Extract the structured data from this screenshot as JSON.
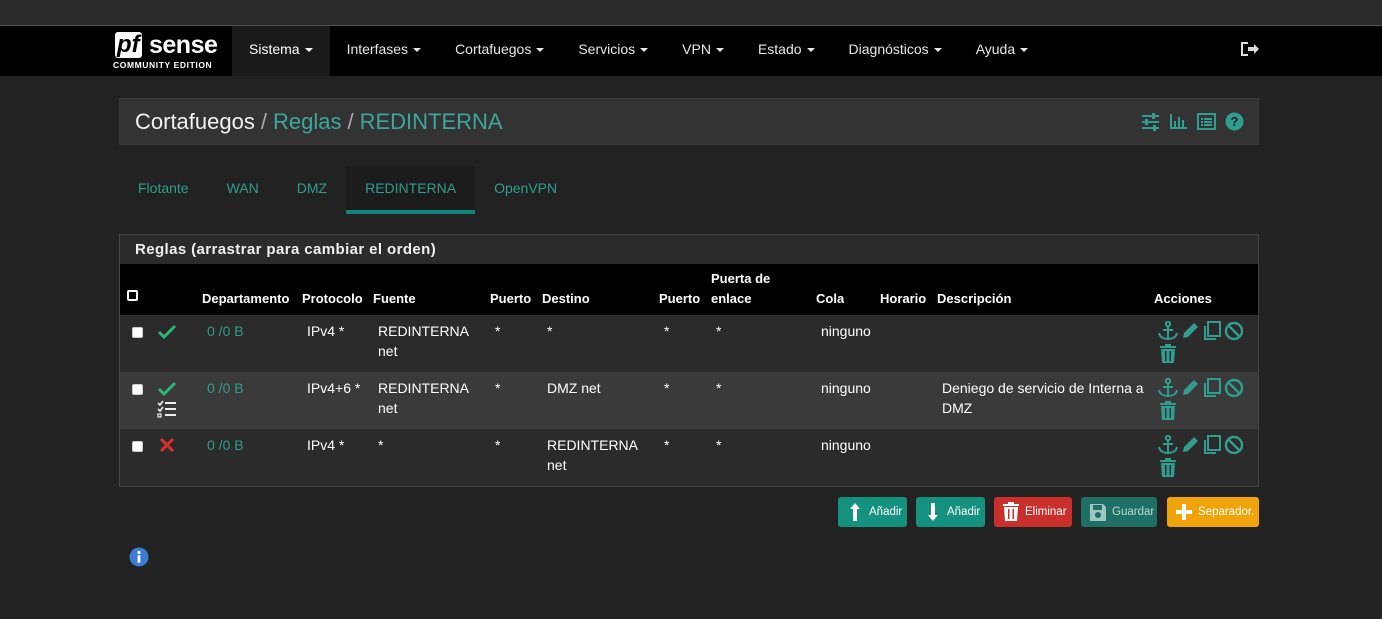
{
  "brand": {
    "logo_pf": "pf",
    "logo_sense": "sense",
    "edition": "COMMUNITY EDITION"
  },
  "nav": {
    "items": [
      {
        "label": "Sistema"
      },
      {
        "label": "Interfases"
      },
      {
        "label": "Cortafuegos"
      },
      {
        "label": "Servicios"
      },
      {
        "label": "VPN"
      },
      {
        "label": "Estado"
      },
      {
        "label": "Diagnósticos"
      },
      {
        "label": "Ayuda"
      }
    ],
    "active": "Sistema",
    "logout_icon": "sign-out-icon"
  },
  "breadcrumb": {
    "part1": "Cortafuegos",
    "sep": "/",
    "part2": "Reglas",
    "part3": "REDINTERNA"
  },
  "header_icons": [
    "sliders-icon",
    "bar-chart-icon",
    "list-icon",
    "help-icon"
  ],
  "tabs": [
    {
      "label": "Flotante"
    },
    {
      "label": "WAN"
    },
    {
      "label": "DMZ"
    },
    {
      "label": "REDINTERNA"
    },
    {
      "label": "OpenVPN"
    }
  ],
  "active_tab": "REDINTERNA",
  "rules": {
    "title": "Reglas (arrastrar para cambiar el orden)",
    "columns": {
      "departamento": "Departamento",
      "protocolo": "Protocolo",
      "fuente": "Fuente",
      "puerto1": "Puerto",
      "destino": "Destino",
      "puerto2": "Puerto",
      "puerta_line1": "Puerta de",
      "puerta_line2": "enlace",
      "cola": "Cola",
      "horario": "Horario",
      "descripcion": "Descripción",
      "acciones": "Acciones"
    },
    "rows": [
      {
        "status": "pass",
        "departamento": "0 /0 B",
        "protocolo": "IPv4 *",
        "fuente_l1": "REDINTERNA",
        "fuente_l2": "net",
        "puerto1": "*",
        "destino_l1": "*",
        "destino_l2": "",
        "puerto2": "*",
        "puerta": "*",
        "cola": "ninguno",
        "horario": "",
        "desc_l1": "",
        "desc_l2": ""
      },
      {
        "status": "pass",
        "has_list_icon": true,
        "departamento": "0 /0 B",
        "protocolo": "IPv4+6 *",
        "fuente_l1": "REDINTERNA",
        "fuente_l2": "net",
        "puerto1": "*",
        "destino_l1": "DMZ net",
        "destino_l2": "",
        "puerto2": "*",
        "puerta": "*",
        "cola": "ninguno",
        "horario": "",
        "desc_l1": "Deniego de servicio de Interna a",
        "desc_l2": "DMZ"
      },
      {
        "status": "block",
        "departamento": "0 /0 B",
        "protocolo": "IPv4 *",
        "fuente_l1": "*",
        "fuente_l2": "",
        "puerto1": "*",
        "destino_l1": "REDINTERNA",
        "destino_l2": "net",
        "puerto2": "*",
        "puerta": "*",
        "cola": "ninguno",
        "horario": "",
        "desc_l1": "",
        "desc_l2": ""
      }
    ],
    "action_icons": [
      "anchor-icon",
      "pencil-icon",
      "copy-icon",
      "ban-icon",
      "trash-icon"
    ]
  },
  "buttons": {
    "add_top": "Añadir",
    "add_bottom": "Añadir",
    "delete": "Eliminar",
    "save": "Guardar",
    "separator": "Separador."
  },
  "colors": {
    "accent": "#2f9d8f",
    "add_button": "#14917f",
    "delete_button": "#c9302c",
    "save_button": "#1e6f66",
    "separator_button": "#f0a30a",
    "pass": "#2bb673",
    "block": "#d9302c",
    "info": "#3a7bd5"
  }
}
